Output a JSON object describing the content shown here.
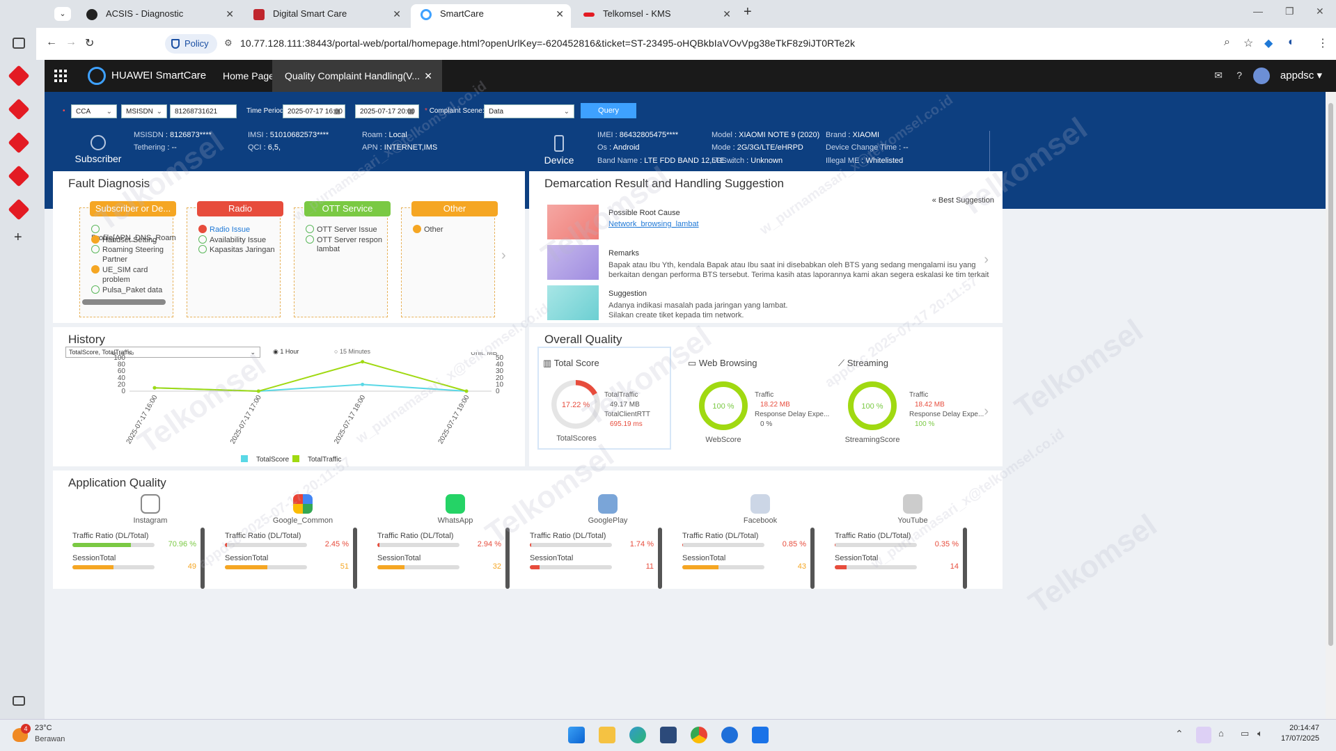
{
  "browser": {
    "tabs": [
      {
        "title": "ACSIS - Diagnostic"
      },
      {
        "title": "Digital Smart Care"
      },
      {
        "title": "SmartCare"
      },
      {
        "title": "Telkomsel - KMS"
      }
    ],
    "policy_label": "Policy",
    "url": "10.77.128.111:38443/portal-web/portal/homepage.html?openUrlKey=-620452816&ticket=ST-23495-oHQBkbIaVOvVpg38eTkF8z9iJT0RTe2k"
  },
  "app": {
    "brand": "HUAWEI SmartCare",
    "home_label": "Home Page",
    "active_tab": "Quality Complaint Handling(V...",
    "user": "appdsc"
  },
  "query": {
    "type": "CCA",
    "id_type": "MSISDN",
    "number": "81268731621",
    "time_label": "Time Period:",
    "start": "2025-07-17 16:00",
    "end": "2025-07-17 20:00",
    "scene_label": "Complaint Scene:",
    "scene": "Data",
    "query_btn": "Query"
  },
  "subscriber": {
    "label": "Subscriber",
    "fields": [
      {
        "k": "MSISDN",
        "v": "8126873****"
      },
      {
        "k": "Tethering",
        "v": "--"
      },
      {
        "k": "IMSI",
        "v": "51010682573****"
      },
      {
        "k": "QCI",
        "v": "6,5,"
      },
      {
        "k": "Roam",
        "v": "Local"
      },
      {
        "k": "APN",
        "v": "INTERNET,IMS"
      }
    ]
  },
  "device": {
    "label": "Device",
    "fields": [
      {
        "k": "IMEI",
        "v": "86432805475****"
      },
      {
        "k": "Os",
        "v": "Android"
      },
      {
        "k": "Band Name",
        "v": "LTE FDD BAND 12,LTE ..."
      },
      {
        "k": "Model",
        "v": "XIAOMI NOTE 9 (2020)"
      },
      {
        "k": "Mode",
        "v": "2G/3G/LTE/eHRPD"
      },
      {
        "k": "5GSwitch",
        "v": "Unknown"
      },
      {
        "k": "Brand",
        "v": "XIAOMI"
      },
      {
        "k": "Device Change Time",
        "v": "--"
      },
      {
        "k": "Illegal ME",
        "v": "Whitelisted"
      }
    ]
  },
  "fault": {
    "title": "Fault Diagnosis",
    "cards": [
      {
        "head": "Subscriber or De...",
        "color": "#f5a623",
        "items": [
          {
            "t": "Profile[APN_DNS_Roam",
            "s": "ok"
          },
          {
            "t": "Handset Setting",
            "s": "warn"
          },
          {
            "t": "Roaming Steering",
            "s": "ok"
          },
          {
            "t": "Partner",
            "s": ""
          },
          {
            "t": "UE_SIM card",
            "s": "warn"
          },
          {
            "t": "problem",
            "s": ""
          },
          {
            "t": "Pulsa_Paket data",
            "s": "ok"
          }
        ]
      },
      {
        "head": "Radio",
        "color": "#e74c3c",
        "items": [
          {
            "t": "Radio Issue",
            "s": "err"
          },
          {
            "t": "Availability Issue",
            "s": "ok"
          },
          {
            "t": "Kapasitas Jaringan",
            "s": "ok"
          }
        ]
      },
      {
        "head": "OTT Service",
        "color": "#7ac943",
        "items": [
          {
            "t": "OTT Server Issue",
            "s": "ok"
          },
          {
            "t": "OTT Server respon",
            "s": "ok"
          },
          {
            "t": "lambat",
            "s": ""
          }
        ]
      },
      {
        "head": "Other",
        "color": "#f5a623",
        "items": [
          {
            "t": "Other",
            "s": "warn"
          }
        ]
      }
    ]
  },
  "demarcation": {
    "title": "Demarcation Result and Handling Suggestion",
    "best": "Best Suggestion",
    "root_label": "Possible Root Cause",
    "root_value": "Network_browsing_lambat",
    "remarks_label": "Remarks",
    "remarks_text": "Bapak atau Ibu Yth, kendala Bapak atau Ibu saat ini disebabkan oleh BTS yang sedang mengalami isu yang berkaitan dengan performa BTS tersebut. Terima kasih atas laporannya kami akan segera eskalasi ke tim terkait",
    "suggestion_label": "Suggestion",
    "suggestion_text_1": "Adanya indikasi masalah pada jaringan yang lambat.",
    "suggestion_text_2": "Silakan create tiket kepada tim network."
  },
  "history": {
    "title": "History",
    "select": "TotalScore, TotalTraffic",
    "opt1": "1 Hour",
    "opt2": "15 Minutes",
    "unit_left": "Unit: %",
    "unit_right": "Unit: MB"
  },
  "chart_data": {
    "type": "line",
    "categories": [
      "2025-07-17 16:00",
      "2025-07-17 17:00",
      "2025-07-17 18:00",
      "2025-07-17 19:00"
    ],
    "series": [
      {
        "name": "TotalScore",
        "color": "#5ad8e6",
        "axis": "left",
        "values": [
          10,
          0,
          20,
          0
        ]
      },
      {
        "name": "TotalTraffic",
        "color": "#a0d911",
        "axis": "right",
        "values": [
          5,
          0,
          44,
          0
        ]
      }
    ],
    "ylim_left": [
      0,
      100
    ],
    "yticks_left": [
      0,
      20,
      40,
      60,
      80,
      100
    ],
    "ylim_right": [
      0,
      50
    ],
    "yticks_right": [
      0,
      10,
      20,
      30,
      40,
      50
    ],
    "ylabel_left": "Unit: %",
    "ylabel_right": "Unit: MB",
    "legend": "bottom"
  },
  "overall": {
    "title": "Overall Quality",
    "total": {
      "title": "Total Score",
      "score": "17.22 %",
      "score_frac": 0.1722,
      "caption": "TotalScores",
      "k1": "TotalTraffic",
      "v1": "49.17 MB",
      "k2": "TotalClientRTT",
      "v2": "695.19 ms"
    },
    "web": {
      "title": "Web Browsing",
      "score": "100 %",
      "caption": "WebScore",
      "k1": "Traffic",
      "v1": "18.22 MB",
      "k2": "Response Delay Expe...",
      "v2": "0 %"
    },
    "stream": {
      "title": "Streaming",
      "score": "100 %",
      "caption": "StreamingScore",
      "k1": "Traffic",
      "v1": "18.42 MB",
      "k2": "Response Delay Expe...",
      "v2": "100 %"
    }
  },
  "appq": {
    "title": "Application Quality",
    "ratio_label": "Traffic Ratio (DL/Total)",
    "session_label": "SessionTotal",
    "apps": [
      {
        "name": "Instagram",
        "ratio": "70.96 %",
        "ratio_frac": 0.7096,
        "session": "49",
        "session_frac": 0.5,
        "color": "#7ac943",
        "scolor": "#f5a623"
      },
      {
        "name": "Google_Common",
        "ratio": "2.45 %",
        "ratio_frac": 0.0245,
        "session": "51",
        "session_frac": 0.52,
        "color": "#e74c3c",
        "scolor": "#f5a623"
      },
      {
        "name": "WhatsApp",
        "ratio": "2.94 %",
        "ratio_frac": 0.0294,
        "session": "32",
        "session_frac": 0.33,
        "color": "#e74c3c",
        "scolor": "#f5a623"
      },
      {
        "name": "GooglePlay",
        "ratio": "1.74 %",
        "ratio_frac": 0.0174,
        "session": "11",
        "session_frac": 0.12,
        "color": "#e74c3c",
        "scolor": "#e74c3c"
      },
      {
        "name": "Facebook",
        "ratio": "0.85 %",
        "ratio_frac": 0.0085,
        "session": "43",
        "session_frac": 0.44,
        "color": "#e74c3c",
        "scolor": "#f5a623"
      },
      {
        "name": "YouTube",
        "ratio": "0.35 %",
        "ratio_frac": 0.0035,
        "session": "14",
        "session_frac": 0.14,
        "color": "#e74c3c",
        "scolor": "#e74c3c"
      }
    ]
  },
  "taskbar": {
    "weather_temp": "23°C",
    "weather_text": "Berawan",
    "badge": "4",
    "time": "20:14:47",
    "date": "17/07/2025"
  },
  "watermarks": [
    "Telkomsel",
    "w_purnamasari_x@telkomsel.co.id",
    "appdsc 2025-07-17 20:11:57"
  ]
}
